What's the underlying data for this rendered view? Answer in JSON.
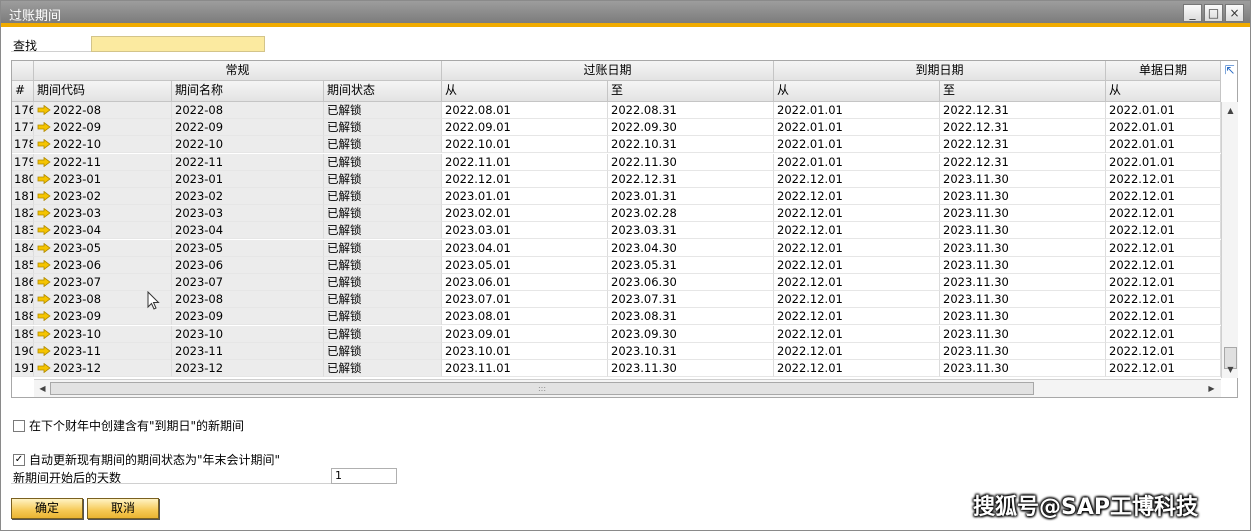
{
  "window": {
    "title": "过账期间",
    "minimize": "_",
    "maximize": "□",
    "close": "×"
  },
  "find": {
    "label": "查找",
    "value": ""
  },
  "grid": {
    "group_headers": {
      "general": "常规",
      "posting_date": "过账日期",
      "due_date": "到期日期",
      "doc_date": "单据日期"
    },
    "columns": {
      "num": "#",
      "period_code": "期间代码",
      "period_name": "期间名称",
      "period_status": "期间状态",
      "from": "从",
      "to": "至"
    },
    "rows": [
      {
        "n": "176",
        "code": "2022-08",
        "name": "2022-08",
        "status": "已解锁",
        "pf": "2022.08.01",
        "pt": "2022.08.31",
        "df": "2022.01.01",
        "dt": "2022.12.31",
        "docf": "2022.01.01"
      },
      {
        "n": "177",
        "code": "2022-09",
        "name": "2022-09",
        "status": "已解锁",
        "pf": "2022.09.01",
        "pt": "2022.09.30",
        "df": "2022.01.01",
        "dt": "2022.12.31",
        "docf": "2022.01.01"
      },
      {
        "n": "178",
        "code": "2022-10",
        "name": "2022-10",
        "status": "已解锁",
        "pf": "2022.10.01",
        "pt": "2022.10.31",
        "df": "2022.01.01",
        "dt": "2022.12.31",
        "docf": "2022.01.01"
      },
      {
        "n": "179",
        "code": "2022-11",
        "name": "2022-11",
        "status": "已解锁",
        "pf": "2022.11.01",
        "pt": "2022.11.30",
        "df": "2022.01.01",
        "dt": "2022.12.31",
        "docf": "2022.01.01"
      },
      {
        "n": "180",
        "code": "2023-01",
        "name": "2023-01",
        "status": "已解锁",
        "pf": "2022.12.01",
        "pt": "2022.12.31",
        "df": "2022.12.01",
        "dt": "2023.11.30",
        "docf": "2022.12.01"
      },
      {
        "n": "181",
        "code": "2023-02",
        "name": "2023-02",
        "status": "已解锁",
        "pf": "2023.01.01",
        "pt": "2023.01.31",
        "df": "2022.12.01",
        "dt": "2023.11.30",
        "docf": "2022.12.01"
      },
      {
        "n": "182",
        "code": "2023-03",
        "name": "2023-03",
        "status": "已解锁",
        "pf": "2023.02.01",
        "pt": "2023.02.28",
        "df": "2022.12.01",
        "dt": "2023.11.30",
        "docf": "2022.12.01"
      },
      {
        "n": "183",
        "code": "2023-04",
        "name": "2023-04",
        "status": "已解锁",
        "pf": "2023.03.01",
        "pt": "2023.03.31",
        "df": "2022.12.01",
        "dt": "2023.11.30",
        "docf": "2022.12.01"
      },
      {
        "n": "184",
        "code": "2023-05",
        "name": "2023-05",
        "status": "已解锁",
        "pf": "2023.04.01",
        "pt": "2023.04.30",
        "df": "2022.12.01",
        "dt": "2023.11.30",
        "docf": "2022.12.01"
      },
      {
        "n": "185",
        "code": "2023-06",
        "name": "2023-06",
        "status": "已解锁",
        "pf": "2023.05.01",
        "pt": "2023.05.31",
        "df": "2022.12.01",
        "dt": "2023.11.30",
        "docf": "2022.12.01"
      },
      {
        "n": "186",
        "code": "2023-07",
        "name": "2023-07",
        "status": "已解锁",
        "pf": "2023.06.01",
        "pt": "2023.06.30",
        "df": "2022.12.01",
        "dt": "2023.11.30",
        "docf": "2022.12.01"
      },
      {
        "n": "187",
        "code": "2023-08",
        "name": "2023-08",
        "status": "已解锁",
        "pf": "2023.07.01",
        "pt": "2023.07.31",
        "df": "2022.12.01",
        "dt": "2023.11.30",
        "docf": "2022.12.01"
      },
      {
        "n": "188",
        "code": "2023-09",
        "name": "2023-09",
        "status": "已解锁",
        "pf": "2023.08.01",
        "pt": "2023.08.31",
        "df": "2022.12.01",
        "dt": "2023.11.30",
        "docf": "2022.12.01"
      },
      {
        "n": "189",
        "code": "2023-10",
        "name": "2023-10",
        "status": "已解锁",
        "pf": "2023.09.01",
        "pt": "2023.09.30",
        "df": "2022.12.01",
        "dt": "2023.11.30",
        "docf": "2022.12.01"
      },
      {
        "n": "190",
        "code": "2023-11",
        "name": "2023-11",
        "status": "已解锁",
        "pf": "2023.10.01",
        "pt": "2023.10.31",
        "df": "2022.12.01",
        "dt": "2023.11.30",
        "docf": "2022.12.01"
      },
      {
        "n": "191",
        "code": "2023-12",
        "name": "2023-12",
        "status": "已解锁",
        "pf": "2023.11.01",
        "pt": "2023.11.30",
        "df": "2022.12.01",
        "dt": "2023.11.30",
        "docf": "2022.12.01"
      }
    ]
  },
  "options": {
    "create_new_period": {
      "label": "在下个财年中创建含有\"到期日\"的新期间",
      "checked": false
    },
    "auto_update_status": {
      "label": "自动更新现有期间的期间状态为\"年末会计期间\"",
      "checked": true,
      "check_mark": "✓"
    },
    "days_after_start": {
      "label": "新期间开始后的天数",
      "value": "1"
    }
  },
  "buttons": {
    "ok": "确定",
    "cancel": "取消"
  },
  "watermark": "搜狐号@SAP工博科技",
  "colors": {
    "accent": "#f0ab00",
    "find_input": "#fbeaa0",
    "button": "#f6c955"
  }
}
